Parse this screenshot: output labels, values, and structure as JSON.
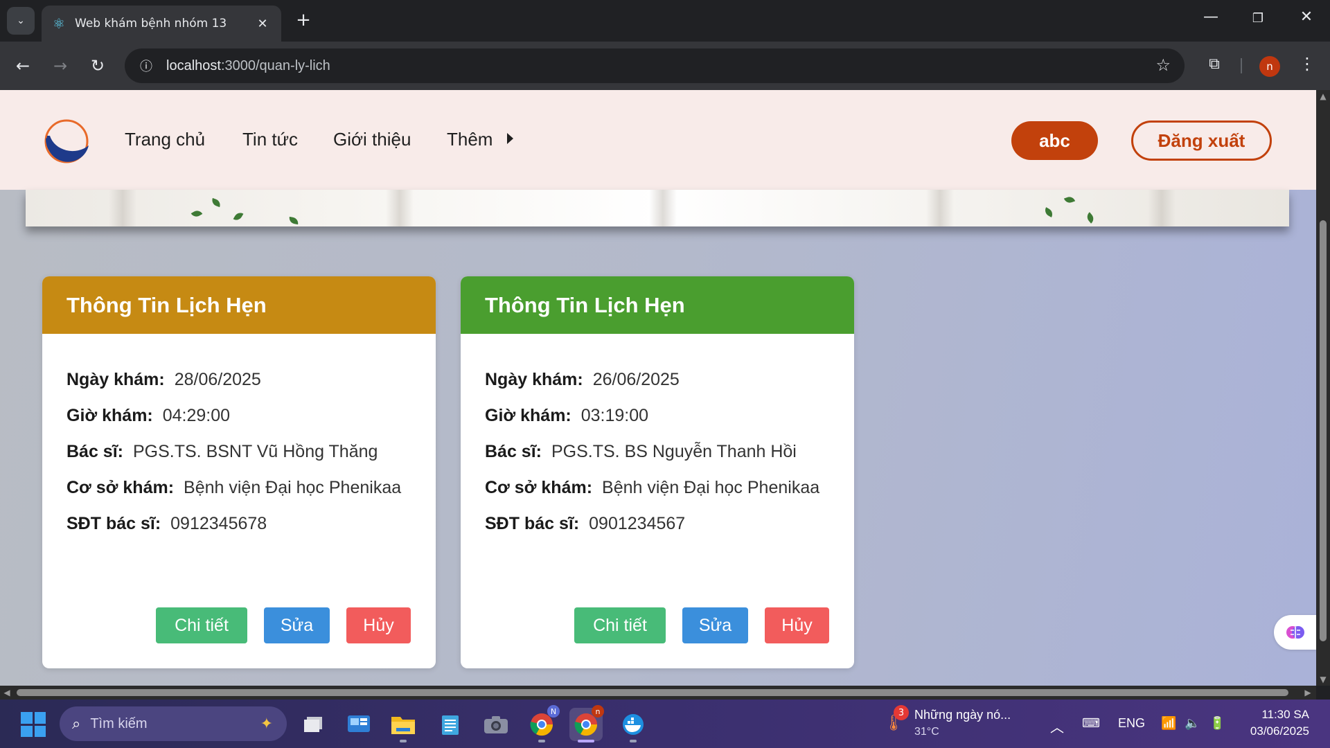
{
  "browser": {
    "tab_title": "Web khám bệnh nhóm 13",
    "url_host": "localhost",
    "url_path": ":3000/quan-ly-lich",
    "profile_initial": "n"
  },
  "site": {
    "nav": [
      "Trang chủ",
      "Tin tức",
      "Giới thiệu",
      "Thêm"
    ],
    "user_name": "abc",
    "logout_label": "Đăng xuất"
  },
  "labels": {
    "date": "Ngày khám:",
    "time": "Giờ khám:",
    "doctor": "Bác sĩ:",
    "facility": "Cơ sở khám:",
    "phone": "SĐT bác sĩ:"
  },
  "buttons": {
    "detail": "Chi tiết",
    "edit": "Sửa",
    "cancel": "Hủy"
  },
  "appointments": [
    {
      "title": "Thông Tin Lịch Hẹn",
      "header_color": "#c68a13",
      "date": "28/06/2025",
      "time": "04:29:00",
      "doctor": "PGS.TS. BSNT Vũ Hồng Thăng",
      "facility": "Bệnh viện Đại học Phenikaa",
      "phone": "0912345678"
    },
    {
      "title": "Thông Tin Lịch Hẹn",
      "header_color": "#4a9e2f",
      "date": "26/06/2025",
      "time": "03:19:00",
      "doctor": "PGS.TS. BS Nguyễn Thanh Hồi",
      "facility": "Bệnh viện Đại học Phenikaa",
      "phone": "0901234567"
    }
  ],
  "taskbar": {
    "search_placeholder": "Tìm kiếm",
    "weather_badge": "3",
    "weather_title": "Những ngày nó...",
    "weather_temp": "31°C",
    "language": "ENG",
    "time": "11:30 SA",
    "date": "03/06/2025",
    "chrome_badge_1": "N",
    "chrome_badge_2": "n"
  }
}
